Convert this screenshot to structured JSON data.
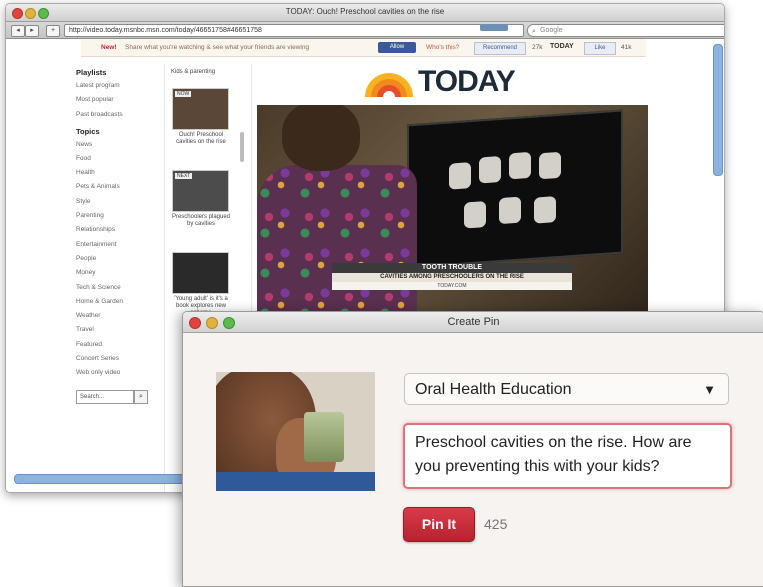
{
  "browser": {
    "window_title": "TODAY: Ouch! Preschool cavities on the rise",
    "url": "http://video.today.msnbc.msn.com/today/46651758#46651758",
    "search_placeholder": "Google",
    "nav_back": "◂",
    "nav_forward": "▸",
    "nav_add": "+"
  },
  "notification": {
    "new_label": "New!",
    "message": "Share what you're watching & see what your friends are viewing",
    "allow_button": "Allow",
    "whos_label": "Who's this?",
    "recommend_label": "Recommend",
    "recommend_count": "27k",
    "today_label": "TODAY",
    "like_label": "Like",
    "like_count": "41k"
  },
  "sidebar": {
    "playlists_heading": "Playlists",
    "playlists": [
      "Latest program",
      "Most popular",
      "Past broadcasts"
    ],
    "topics_heading": "Topics",
    "topics": [
      "News",
      "Food",
      "Health",
      "Pets & Animals",
      "Style",
      "Parenting",
      "Relationships",
      "Entertainment",
      "People",
      "Money",
      "Tech & Science",
      "Home & Garden",
      "Weather",
      "Travel",
      "Featured",
      "Concert Series",
      "Web only video"
    ],
    "search_placeholder": "Search...",
    "search_go": "🔍"
  },
  "thumbs": {
    "heading": "Kids & parenting",
    "items": [
      {
        "tag": "NOW",
        "caption": "Ouch! Preschool cavities on the rise"
      },
      {
        "tag": "NEXT",
        "caption": "Preschoolers plagued by cavities"
      },
      {
        "tag": "",
        "caption": "'Young adult' is it's a book explores new scheme"
      }
    ]
  },
  "today_logo": "TODAY",
  "video": {
    "lower_third_title": "TOOTH TROUBLE",
    "lower_third_sub": "CAVITIES AMONG PRESCHOOLERS ON THE RISE",
    "lower_third_brand": "TODAY.COM"
  },
  "pin_dialog": {
    "title": "Create Pin",
    "board": "Oral Health Education",
    "description": "Preschool cavities on the rise. How are you preventing this with your kids?",
    "button_label": "Pin It",
    "char_count": "425"
  },
  "colors": {
    "pin_button": "#c82c3a",
    "desc_border": "#d9747a",
    "facebook_blue": "#3b5998"
  }
}
